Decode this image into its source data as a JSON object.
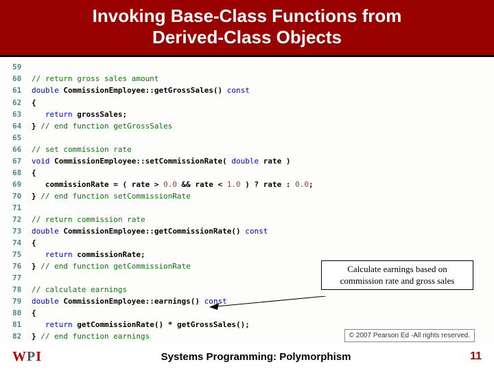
{
  "title_line1": "Invoking Base-Class Functions from",
  "title_line2": "Derived-Class Objects",
  "code": {
    "l59": {
      "n": "59",
      "t": ""
    },
    "l60": {
      "n": "60",
      "c": "// return gross sales amount"
    },
    "l61": {
      "n": "61",
      "kw": "double",
      "t1": " CommissionEmployee::getGrossSales() ",
      "kw2": "const"
    },
    "l62": {
      "n": "62",
      "t": "{"
    },
    "l63": {
      "n": "63",
      "t": "   ",
      "kw": "return",
      "t2": " grossSales;"
    },
    "l64": {
      "n": "64",
      "t": "} ",
      "c": "// end function getGrossSales"
    },
    "l65": {
      "n": "65",
      "t": ""
    },
    "l66": {
      "n": "66",
      "c": "// set commission rate"
    },
    "l67": {
      "n": "67",
      "kw": "void",
      "t1": " CommissionEmployee::setCommissionRate( ",
      "kw2": "double",
      "t2": " rate )"
    },
    "l68": {
      "n": "68",
      "t": "{"
    },
    "l69": {
      "n": "69",
      "t": "   commissionRate = ( rate > ",
      "n1": "0.0",
      "t2": " && rate < ",
      "n2": "1.0",
      "t3": " ) ? rate : ",
      "n3": "0.0",
      "t4": ";"
    },
    "l70": {
      "n": "70",
      "t": "} ",
      "c": "// end function setCommissionRate"
    },
    "l71": {
      "n": "71",
      "t": ""
    },
    "l72": {
      "n": "72",
      "c": "// return commission rate"
    },
    "l73": {
      "n": "73",
      "kw": "double",
      "t1": " CommissionEmployee::getCommissionRate() ",
      "kw2": "const"
    },
    "l74": {
      "n": "74",
      "t": "{"
    },
    "l75": {
      "n": "75",
      "t": "   ",
      "kw": "return",
      "t2": " commissionRate;"
    },
    "l76": {
      "n": "76",
      "t": "} ",
      "c": "// end function getCommissionRate"
    },
    "l77": {
      "n": "77",
      "t": ""
    },
    "l78": {
      "n": "78",
      "c": "// calculate earnings"
    },
    "l79": {
      "n": "79",
      "kw": "double",
      "t1": " CommissionEmployee::earnings() ",
      "kw2": "const"
    },
    "l80": {
      "n": "80",
      "t": "{"
    },
    "l81": {
      "n": "81",
      "t": "   ",
      "kw": "return",
      "t2": " getCommissionRate() * getGrossSales();"
    },
    "l82": {
      "n": "82",
      "t": "} ",
      "c": "// end function earnings"
    }
  },
  "callout_line1": "Calculate earnings based on",
  "callout_line2": "commission rate and gross sales",
  "copyright": "© 2007 Pearson Ed -All rights reserved.",
  "footer_title": "Systems Programming:  Polymorphism",
  "page_number": "11",
  "logo": {
    "w": "W",
    "p": "P",
    "i": "I"
  }
}
